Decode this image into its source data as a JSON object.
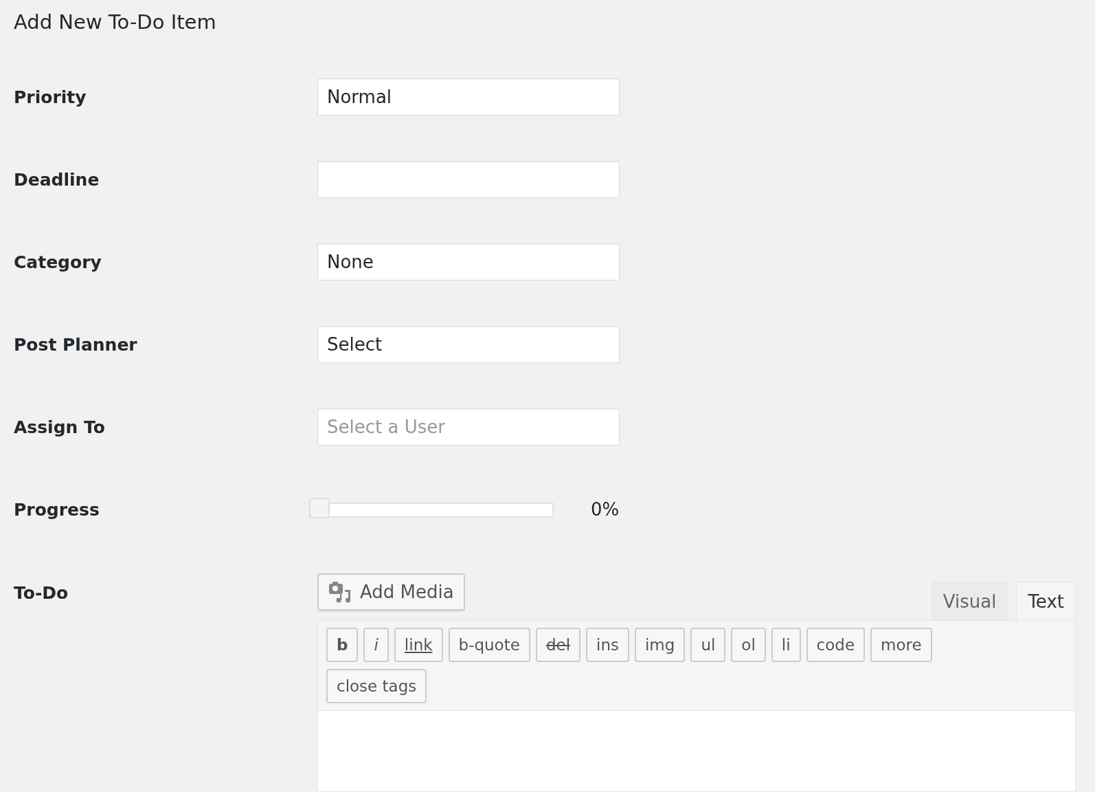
{
  "page_title": "Add New To-Do Item",
  "fields": [
    {
      "label": "Priority",
      "kind": "select",
      "value": "Normal"
    },
    {
      "label": "Deadline",
      "kind": "text"
    },
    {
      "label": "Category",
      "kind": "select",
      "value": "None"
    },
    {
      "label": "Post Planner",
      "kind": "select",
      "value": "Select"
    },
    {
      "label": "Assign To",
      "kind": "text",
      "placeholder": "Select a User"
    },
    {
      "label": "Progress",
      "kind": "slider",
      "level": 0,
      "reading": "0%"
    }
  ],
  "todo": {
    "label": "To-Do",
    "add_media": "Add Media",
    "tabs": [
      {
        "label": "Visual",
        "selected": false
      },
      {
        "label": "Text",
        "selected": true
      }
    ],
    "quicktags": [
      {
        "label": "b",
        "kind": "bold"
      },
      {
        "label": "i",
        "kind": "italic"
      },
      {
        "label": "link",
        "kind": "link"
      },
      {
        "label": "b-quote",
        "kind": "plain"
      },
      {
        "label": "del",
        "kind": "strike"
      },
      {
        "label": "ins",
        "kind": "plain"
      },
      {
        "label": "img",
        "kind": "plain"
      },
      {
        "label": "ul",
        "kind": "plain"
      },
      {
        "label": "ol",
        "kind": "plain"
      },
      {
        "label": "li",
        "kind": "plain"
      },
      {
        "label": "code",
        "kind": "plain"
      },
      {
        "label": "more",
        "kind": "plain"
      },
      {
        "label": "close tags",
        "kind": "plain"
      }
    ]
  }
}
